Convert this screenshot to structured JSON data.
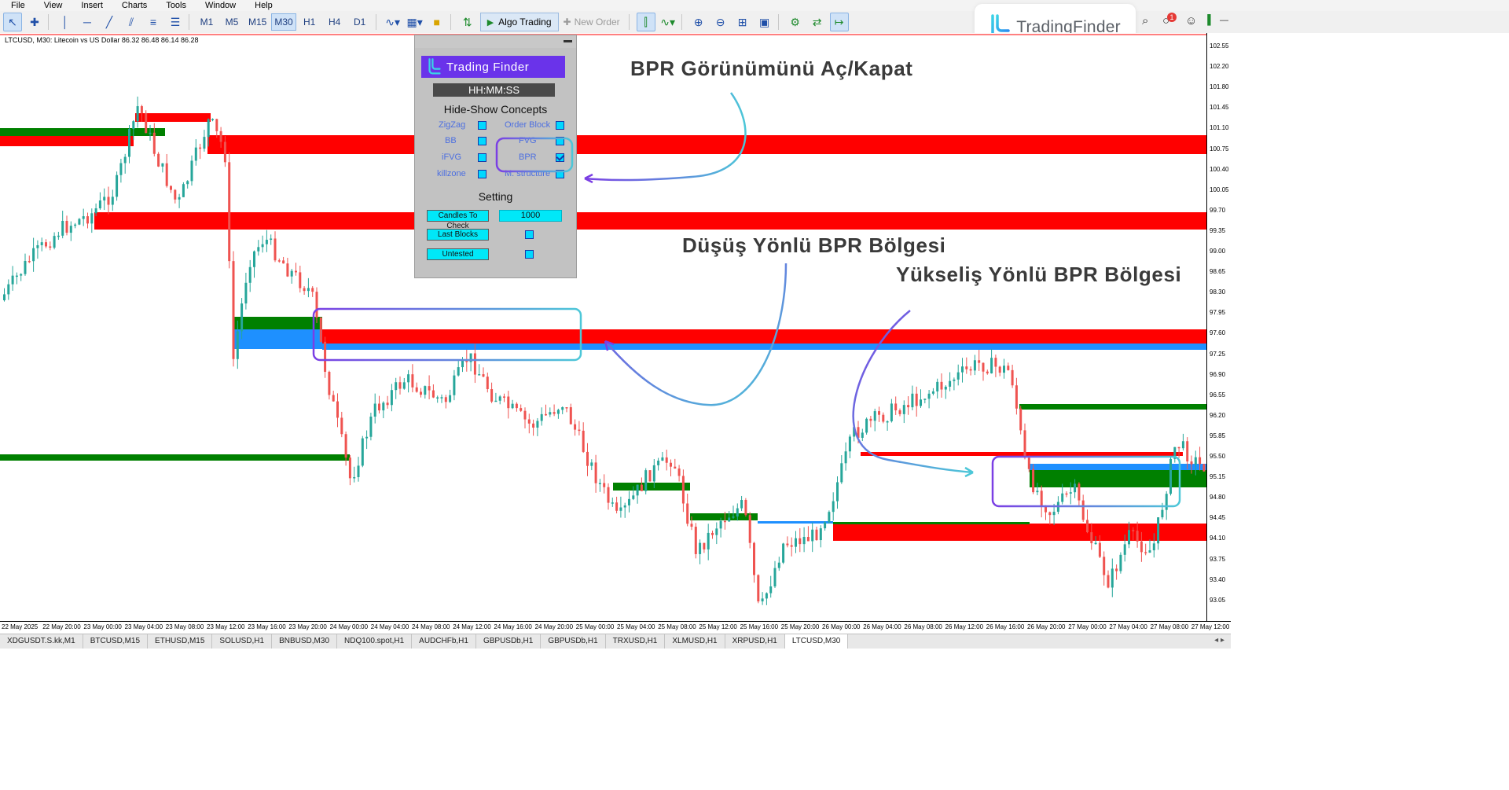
{
  "menu": [
    "File",
    "View",
    "Insert",
    "Charts",
    "Tools",
    "Window",
    "Help"
  ],
  "toolbar": {
    "timeframes": [
      "M1",
      "M5",
      "M15",
      "M30",
      "H1",
      "H4",
      "D1"
    ],
    "active_timeframe": "M30",
    "algo_trading": "Algo Trading",
    "new_order": "New Order"
  },
  "logo": {
    "text": "TradingFinder"
  },
  "notification_count": "1",
  "chart": {
    "label": "LTCUSD, M30:  Litecoin vs US Dollar  86.32 86.48 86.14 86.28",
    "price_labels": [
      "102.55",
      "102.20",
      "101.80",
      "101.45",
      "101.10",
      "100.75",
      "100.40",
      "100.05",
      "99.70",
      "99.35",
      "99.00",
      "98.65",
      "98.30",
      "97.95",
      "97.60",
      "97.25",
      "96.90",
      "96.55",
      "96.20",
      "95.85",
      "95.50",
      "95.15",
      "94.80",
      "94.45",
      "94.10",
      "93.75",
      "93.40",
      "93.05"
    ],
    "date_labels": [
      "22 May 2025",
      "22 May 20:00",
      "23 May 00:00",
      "23 May 04:00",
      "23 May 08:00",
      "23 May 12:00",
      "23 May 16:00",
      "23 May 20:00",
      "24 May 00:00",
      "24 May 04:00",
      "24 May 08:00",
      "24 May 12:00",
      "24 May 16:00",
      "24 May 20:00",
      "25 May 00:00",
      "25 May 04:00",
      "25 May 08:00",
      "25 May 12:00",
      "25 May 16:00",
      "25 May 20:00",
      "26 May 00:00",
      "26 May 04:00",
      "26 May 08:00",
      "26 May 12:00",
      "26 May 16:00",
      "26 May 20:00",
      "27 May 00:00",
      "27 May 04:00",
      "27 May 08:00",
      "27 May 12:00"
    ]
  },
  "tabs": [
    "XDGUSDT.S.kk,M1",
    "BTCUSD,M15",
    "ETHUSD,M15",
    "SOLUSD,H1",
    "BNBUSD,M30",
    "NDQ100.spot,H1",
    "AUDCHFb,H1",
    "GBPUSDb,H1",
    "GBPUSDb,H1",
    "TRXUSD,H1",
    "XLMUSD,H1",
    "XRPUSD,H1",
    "LTCUSD,M30"
  ],
  "active_tab": "LTCUSD,M30",
  "panel": {
    "brand": "Trading Finder",
    "time": "HH:MM:SS",
    "concepts_title": "Hide-Show Concepts",
    "concepts": [
      {
        "label": "ZigZag",
        "checked": false
      },
      {
        "label": "Order Block",
        "checked": false
      },
      {
        "label": "BB",
        "checked": false
      },
      {
        "label": "FVG",
        "checked": false
      },
      {
        "label": "iFVG",
        "checked": false
      },
      {
        "label": "BPR",
        "checked": true
      },
      {
        "label": "killzone",
        "checked": false
      },
      {
        "label": "M. structure",
        "checked": false
      }
    ],
    "setting_title": "Setting",
    "candles_label": "Candles To Check",
    "candles_value": "1000",
    "last_blocks_label": "Last Blocks",
    "untested_label": "Untested"
  },
  "annotations": {
    "toggle": "BPR Görünümünü Aç/Kapat",
    "bearish": "Düşüş Yönlü BPR Bölgesi",
    "bullish": "Yükseliş Yönlü BPR Bölgesi"
  },
  "colors": {
    "bull_candle": "#26a69a",
    "bear_candle": "#ef5350",
    "bearish_zone": "#ff0000",
    "bullish_zone": "#008000",
    "bpr_zone": "#1e90ff",
    "highlight_purple": "#7b3fe4",
    "highlight_cyan": "#4cc7d8"
  }
}
